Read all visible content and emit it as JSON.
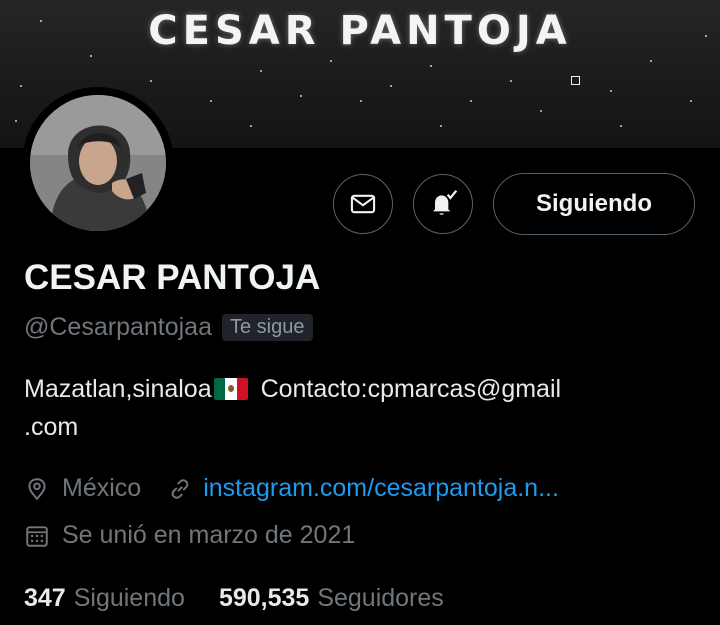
{
  "banner": {
    "title": "CESAR PANTOJA"
  },
  "profile": {
    "name": "CESAR PANTOJA",
    "handle": "@Cesarpantojaa",
    "follows_you": "Te sigue",
    "bio_part1": "Mazatlan,sinaloa",
    "bio_flag_icon": "mexico-flag",
    "bio_part2": " Contacto:cpmarcas@gmail",
    "bio_part3": ".com",
    "location": "México",
    "website": "instagram.com/cesarpantoja.n...",
    "joined": "Se unió en marzo de 2021"
  },
  "actions": {
    "message_icon": "envelope-icon",
    "notify_icon": "bell-check-icon",
    "follow_label": "Siguiendo"
  },
  "stats": {
    "following_count": "347",
    "following_label": "Siguiendo",
    "followers_count": "590,535",
    "followers_label": "Seguidores"
  },
  "colors": {
    "background": "#000000",
    "link": "#1d9bf0",
    "muted": "#71767b",
    "border": "#536471"
  }
}
